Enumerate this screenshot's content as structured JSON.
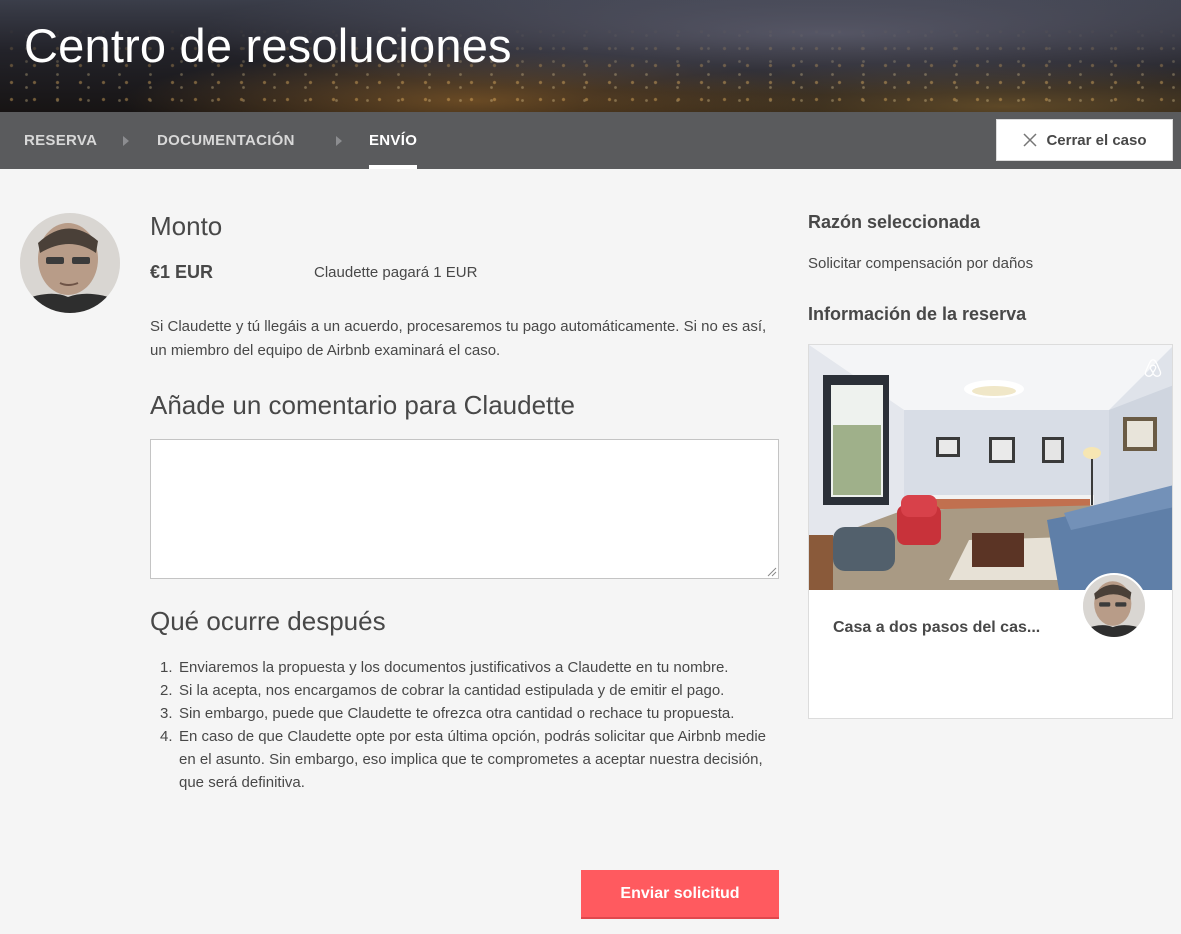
{
  "header": {
    "title": "Centro de resoluciones"
  },
  "steps": [
    {
      "label": "RESERVA",
      "active": false
    },
    {
      "label": "DOCUMENTACIÓN",
      "active": false
    },
    {
      "label": "ENVÍO",
      "active": true
    }
  ],
  "close_case": {
    "label": "Cerrar el caso",
    "icon": "close-icon"
  },
  "amount_section": {
    "heading": "Monto",
    "amount": "€1 EUR",
    "note": "Claudette pagará 1 EUR",
    "description": "Si Claudette y tú llegáis a un acuerdo, procesaremos tu pago automáticamente. Si no es así, un miembro del equipo de Airbnb examinará el caso."
  },
  "comment": {
    "heading": "Añade un comentario para Claudette",
    "value": "",
    "placeholder": ""
  },
  "next_steps": {
    "heading": "Qué ocurre después",
    "items": [
      "Enviaremos la propuesta y los documentos justificativos a Claudette en tu nombre.",
      "Si la acepta, nos encargamos de cobrar la cantidad estipulada y de emitir el pago.",
      "Sin embargo, puede que Claudette te ofrezca otra cantidad o rechace tu propuesta.",
      "En caso de que Claudette opte por esta última opción, podrás solicitar que Airbnb medie en el asunto. Sin embargo, eso implica que te comprometes a aceptar nuestra decisión, que será definitiva."
    ]
  },
  "submit": {
    "label": "Enviar solicitud"
  },
  "sidebar": {
    "reason_heading": "Razón seleccionada",
    "reason_value": "Solicitar compensación por daños",
    "booking_heading": "Información de la reserva",
    "listing_title": "Casa a dos pasos del cas..."
  },
  "colors": {
    "accent": "#ff5a5f",
    "stepbar": "#5a5b5d",
    "text": "#484848",
    "background": "#f5f5f5"
  }
}
